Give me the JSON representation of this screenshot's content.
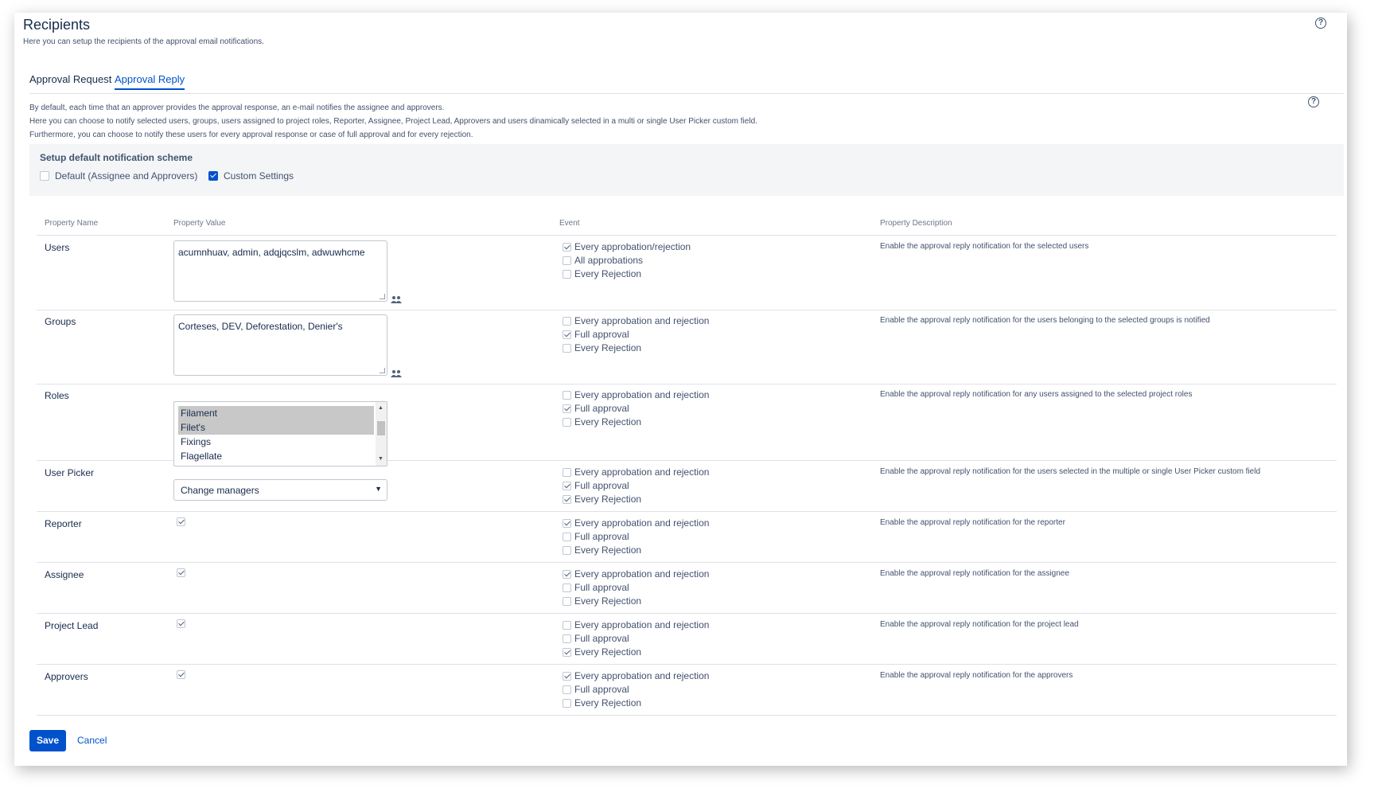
{
  "header": {
    "title": "Recipients",
    "subtitle": "Here you can setup the recipients of the approval email notifications.",
    "help_glyph": "?"
  },
  "tabs": [
    {
      "label": "Approval Request",
      "active": false
    },
    {
      "label": "Approval Reply",
      "active": true
    }
  ],
  "intro": {
    "line1": "By default, each time that an approver provides the approval response, an e-mail notifies the assignee and approvers.",
    "line2": "Here you can choose to notify selected users, groups, users assigned to project roles, Reporter, Assignee, Project Lead, Approvers and users dinamically selected in a multi or single User Picker custom field.",
    "line3": "Furthermore, you can choose to notify these users for every approval response or case of full approval and for every rejection."
  },
  "scheme": {
    "title": "Setup default notification scheme",
    "option_default": "Default (Assignee and Approvers)",
    "option_default_checked": false,
    "option_custom": "Custom Settings",
    "option_custom_checked": true
  },
  "table": {
    "headers": {
      "name": "Property Name",
      "value": "Property Value",
      "event": "Event",
      "description": "Property Description"
    },
    "rows": [
      {
        "name": "Users",
        "value_text": "acumnhuav, admin, adqjqcslm, adwuwhcme",
        "events": [
          {
            "label": "Every approbation/rejection",
            "checked": true
          },
          {
            "label": "All approbations",
            "checked": false
          },
          {
            "label": "Every Rejection",
            "checked": false
          }
        ],
        "description": "Enable the approval reply notification for the selected users"
      },
      {
        "name": "Groups",
        "value_text": "Corteses, DEV, Deforestation, Denier's",
        "events": [
          {
            "label": "Every approbation and rejection",
            "checked": false
          },
          {
            "label": "Full approval",
            "checked": true
          },
          {
            "label": "Every Rejection",
            "checked": false
          }
        ],
        "description": "Enable the approval reply notification for the users belonging to the selected groups is notified"
      },
      {
        "name": "Roles",
        "options": [
          {
            "label": "Filament",
            "selected": true
          },
          {
            "label": "Filet's",
            "selected": true
          },
          {
            "label": "Fixings",
            "selected": false
          },
          {
            "label": "Flagellate",
            "selected": false
          }
        ],
        "events": [
          {
            "label": "Every approbation and rejection",
            "checked": false
          },
          {
            "label": "Full approval",
            "checked": true
          },
          {
            "label": "Every Rejection",
            "checked": false
          }
        ],
        "description": "Enable the approval reply notification for any users assigned to the selected project roles"
      },
      {
        "name": "User Picker",
        "select_value": "Change managers",
        "events": [
          {
            "label": "Every approbation and rejection",
            "checked": false
          },
          {
            "label": "Full approval",
            "checked": true
          },
          {
            "label": "Every Rejection",
            "checked": true
          }
        ],
        "description": "Enable the approval reply notification for the users selected in the multiple or single User Picker custom field"
      },
      {
        "name": "Reporter",
        "value_checked": true,
        "events": [
          {
            "label": "Every approbation and rejection",
            "checked": true
          },
          {
            "label": "Full approval",
            "checked": false
          },
          {
            "label": "Every Rejection",
            "checked": false
          }
        ],
        "description": "Enable the approval reply notification for the reporter"
      },
      {
        "name": "Assignee",
        "value_checked": true,
        "events": [
          {
            "label": "Every approbation and rejection",
            "checked": true
          },
          {
            "label": "Full approval",
            "checked": false
          },
          {
            "label": "Every Rejection",
            "checked": false
          }
        ],
        "description": "Enable the approval reply notification for the assignee"
      },
      {
        "name": "Project Lead",
        "value_checked": true,
        "events": [
          {
            "label": "Every approbation and rejection",
            "checked": false
          },
          {
            "label": "Full approval",
            "checked": false
          },
          {
            "label": "Every Rejection",
            "checked": true
          }
        ],
        "description": "Enable the approval reply notification for the project lead"
      },
      {
        "name": "Approvers",
        "value_checked": true,
        "events": [
          {
            "label": "Every approbation and rejection",
            "checked": true
          },
          {
            "label": "Full approval",
            "checked": false
          },
          {
            "label": "Every Rejection",
            "checked": false
          }
        ],
        "description": "Enable the approval reply notification for the approvers"
      }
    ]
  },
  "actions": {
    "save_label": "Save",
    "cancel_label": "Cancel"
  },
  "icons": {
    "help": "help-icon",
    "user_picker": "people-icon",
    "dropdown": "chevron-down-icon"
  },
  "colors": {
    "accent": "#0052cc",
    "text": "#172b4d",
    "muted": "#42526e",
    "scheme_bg": "#f4f5f7"
  }
}
